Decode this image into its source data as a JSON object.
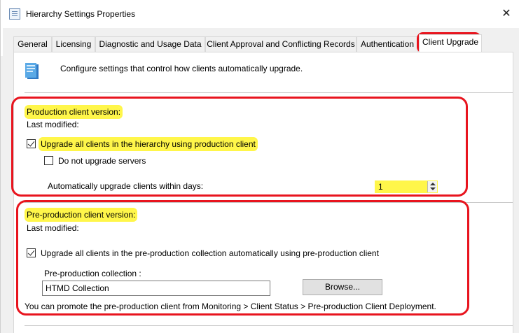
{
  "window": {
    "title": "Hierarchy Settings Properties",
    "close_glyph": "✕"
  },
  "tabs": [
    {
      "label": "General"
    },
    {
      "label": "Licensing"
    },
    {
      "label": "Diagnostic and Usage Data"
    },
    {
      "label": "Client Approval and Conflicting Records"
    },
    {
      "label": "Authentication"
    },
    {
      "label": "Client Upgrade",
      "active": true
    }
  ],
  "header": {
    "description": "Configure settings that control how clients automatically upgrade.",
    "icon": "client-upgrade-icon"
  },
  "production": {
    "version_label": "Production client version:",
    "last_modified_label": "Last modified:",
    "upgrade_all_label": "Upgrade all clients in the hierarchy using production client",
    "upgrade_all_checked": true,
    "no_servers_label": "Do not upgrade servers",
    "no_servers_checked": false,
    "days_label": "Automatically upgrade clients within days:",
    "days_value": "1"
  },
  "preproduction": {
    "version_label": "Pre-production client version:",
    "last_modified_label": "Last modified:",
    "upgrade_all_label": "Upgrade all clients in the pre-production collection automatically using pre-production client",
    "upgrade_all_checked": true,
    "collection_label": "Pre-production collection :",
    "collection_value": "HTMD Collection",
    "browse_label": "Browse...",
    "promote_text": "You can promote the pre-production client from Monitoring > Client Status > Pre-production Client Deployment."
  },
  "colors": {
    "annotation_red": "#e8141e",
    "highlight_yellow": "#fff64a",
    "panel_bg": "#ffffff",
    "dialog_bg": "#f0f0f0"
  }
}
